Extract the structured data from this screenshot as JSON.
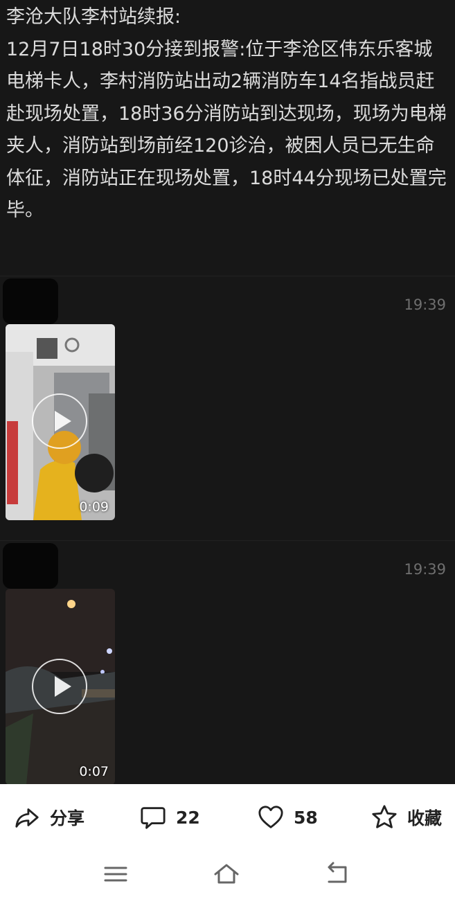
{
  "post": {
    "text": "李沧大队李村站续报:\n12月7日18时30分接到报警:位于李沧区伟东乐客城电梯卡人，李村消防站出动2辆消防车14名指战员赶赴现场处置，18时36分消防站到达现场，现场为电梯夹人，消防站到场前经120诊治，被困人员已无生命体征，消防站正在现场处置，18时44分现场已处置完毕。"
  },
  "messages": [
    {
      "time": "19:39",
      "video_duration": "0:09"
    },
    {
      "time": "19:39",
      "video_duration": "0:07"
    }
  ],
  "actions": {
    "share_label": "分享",
    "comment_count": "22",
    "like_count": "58",
    "favorite_label": "收藏"
  },
  "icons": {
    "share": "share-icon",
    "comment": "comment-icon",
    "like": "heart-icon",
    "favorite": "star-icon",
    "menu": "menu-icon",
    "home": "home-icon",
    "back": "back-icon"
  }
}
